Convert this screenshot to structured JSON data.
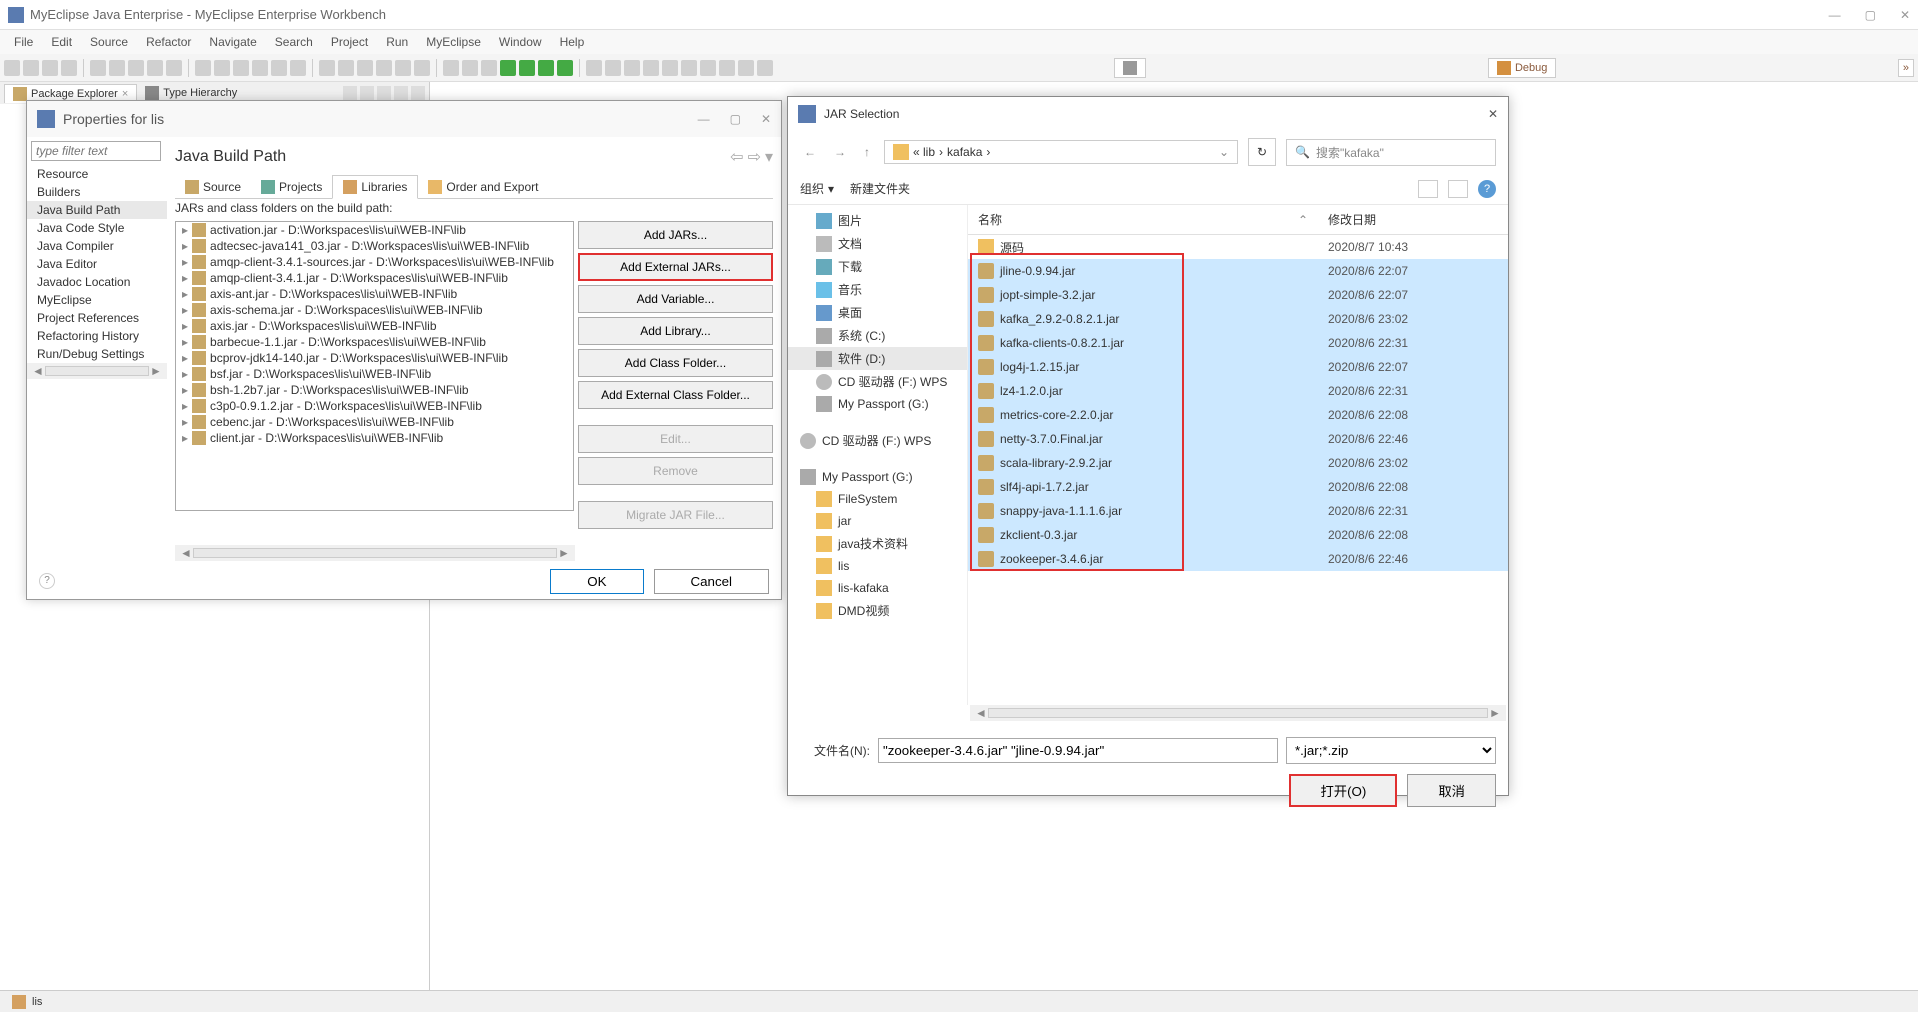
{
  "ide": {
    "title": "MyEclipse Java Enterprise - MyEclipse Enterprise Workbench",
    "menu": [
      "File",
      "Edit",
      "Source",
      "Refactor",
      "Navigate",
      "Search",
      "Project",
      "Run",
      "MyEclipse",
      "Window",
      "Help"
    ],
    "perspective": "Debug",
    "view_tabs": {
      "pkg": "Package Explorer",
      "type": "Type Hierarchy"
    },
    "status_file": "lis"
  },
  "props": {
    "title": "Properties for lis",
    "filter_placeholder": "type filter text",
    "tree": [
      "Resource",
      "Builders",
      "Java Build Path",
      "Java Code Style",
      "Java Compiler",
      "Java Editor",
      "Javadoc Location",
      "MyEclipse",
      "Project References",
      "Refactoring History",
      "Run/Debug Settings"
    ],
    "tree_selected": "Java Build Path",
    "heading": "Java Build Path",
    "tabs": {
      "source": "Source",
      "projects": "Projects",
      "libraries": "Libraries",
      "order": "Order and Export"
    },
    "jar_label": "JARs and class folders on the build path:",
    "jars": [
      "activation.jar - D:\\Workspaces\\lis\\ui\\WEB-INF\\lib",
      "adtecsec-java141_03.jar - D:\\Workspaces\\lis\\ui\\WEB-INF\\lib",
      "amqp-client-3.4.1-sources.jar - D:\\Workspaces\\lis\\ui\\WEB-INF\\lib",
      "amqp-client-3.4.1.jar - D:\\Workspaces\\lis\\ui\\WEB-INF\\lib",
      "axis-ant.jar - D:\\Workspaces\\lis\\ui\\WEB-INF\\lib",
      "axis-schema.jar - D:\\Workspaces\\lis\\ui\\WEB-INF\\lib",
      "axis.jar - D:\\Workspaces\\lis\\ui\\WEB-INF\\lib",
      "barbecue-1.1.jar - D:\\Workspaces\\lis\\ui\\WEB-INF\\lib",
      "bcprov-jdk14-140.jar - D:\\Workspaces\\lis\\ui\\WEB-INF\\lib",
      "bsf.jar - D:\\Workspaces\\lis\\ui\\WEB-INF\\lib",
      "bsh-1.2b7.jar - D:\\Workspaces\\lis\\ui\\WEB-INF\\lib",
      "c3p0-0.9.1.2.jar - D:\\Workspaces\\lis\\ui\\WEB-INF\\lib",
      "cebenc.jar - D:\\Workspaces\\lis\\ui\\WEB-INF\\lib",
      "client.jar - D:\\Workspaces\\lis\\ui\\WEB-INF\\lib"
    ],
    "buttons": {
      "add_jars": "Add JARs...",
      "add_ext_jars": "Add External JARs...",
      "add_var": "Add Variable...",
      "add_lib": "Add Library...",
      "add_cf": "Add Class Folder...",
      "add_ecf": "Add External Class Folder...",
      "edit": "Edit...",
      "remove": "Remove",
      "migrate": "Migrate JAR File..."
    },
    "ok": "OK",
    "cancel": "Cancel"
  },
  "fd": {
    "title": "JAR Selection",
    "breadcrumb": [
      "« lib",
      "kafaka"
    ],
    "search_placeholder": "搜索\"kafaka\"",
    "organize": "组织",
    "new_folder": "新建文件夹",
    "tree": {
      "pics": "图片",
      "docs": "文档",
      "downloads": "下载",
      "music": "音乐",
      "desktop": "桌面",
      "cdrive": "系统 (C:)",
      "ddrive": "软件 (D:)",
      "cd1": "CD 驱动器 (F:) WPS",
      "passport_g1": "My Passport (G:)",
      "cd2": "CD 驱动器 (F:) WPS",
      "passport_g2": "My Passport (G:)",
      "filesystem": "FileSystem",
      "jar": "jar",
      "javatech": "java技术资料",
      "lis": "lis",
      "liskafaka": "lis-kafaka",
      "dmd": "DMD视频"
    },
    "col_name": "名称",
    "col_date": "修改日期",
    "files": [
      {
        "n": "源码",
        "d": "2020/8/7 10:43",
        "folder": true,
        "sel": false
      },
      {
        "n": "jline-0.9.94.jar",
        "d": "2020/8/6 22:07",
        "sel": true
      },
      {
        "n": "jopt-simple-3.2.jar",
        "d": "2020/8/6 22:07",
        "sel": true
      },
      {
        "n": "kafka_2.9.2-0.8.2.1.jar",
        "d": "2020/8/6 23:02",
        "sel": true
      },
      {
        "n": "kafka-clients-0.8.2.1.jar",
        "d": "2020/8/6 22:31",
        "sel": true
      },
      {
        "n": "log4j-1.2.15.jar",
        "d": "2020/8/6 22:07",
        "sel": true
      },
      {
        "n": "lz4-1.2.0.jar",
        "d": "2020/8/6 22:31",
        "sel": true
      },
      {
        "n": "metrics-core-2.2.0.jar",
        "d": "2020/8/6 22:08",
        "sel": true
      },
      {
        "n": "netty-3.7.0.Final.jar",
        "d": "2020/8/6 22:46",
        "sel": true
      },
      {
        "n": "scala-library-2.9.2.jar",
        "d": "2020/8/6 23:02",
        "sel": true
      },
      {
        "n": "slf4j-api-1.7.2.jar",
        "d": "2020/8/6 22:08",
        "sel": true
      },
      {
        "n": "snappy-java-1.1.1.6.jar",
        "d": "2020/8/6 22:31",
        "sel": true
      },
      {
        "n": "zkclient-0.3.jar",
        "d": "2020/8/6 22:08",
        "sel": true
      },
      {
        "n": "zookeeper-3.4.6.jar",
        "d": "2020/8/6 22:46",
        "sel": true
      }
    ],
    "filename_label": "文件名(N):",
    "filename_value": "\"zookeeper-3.4.6.jar\" \"jline-0.9.94.jar\"",
    "filter": "*.jar;*.zip",
    "open": "打开(O)",
    "cancel": "取消"
  }
}
